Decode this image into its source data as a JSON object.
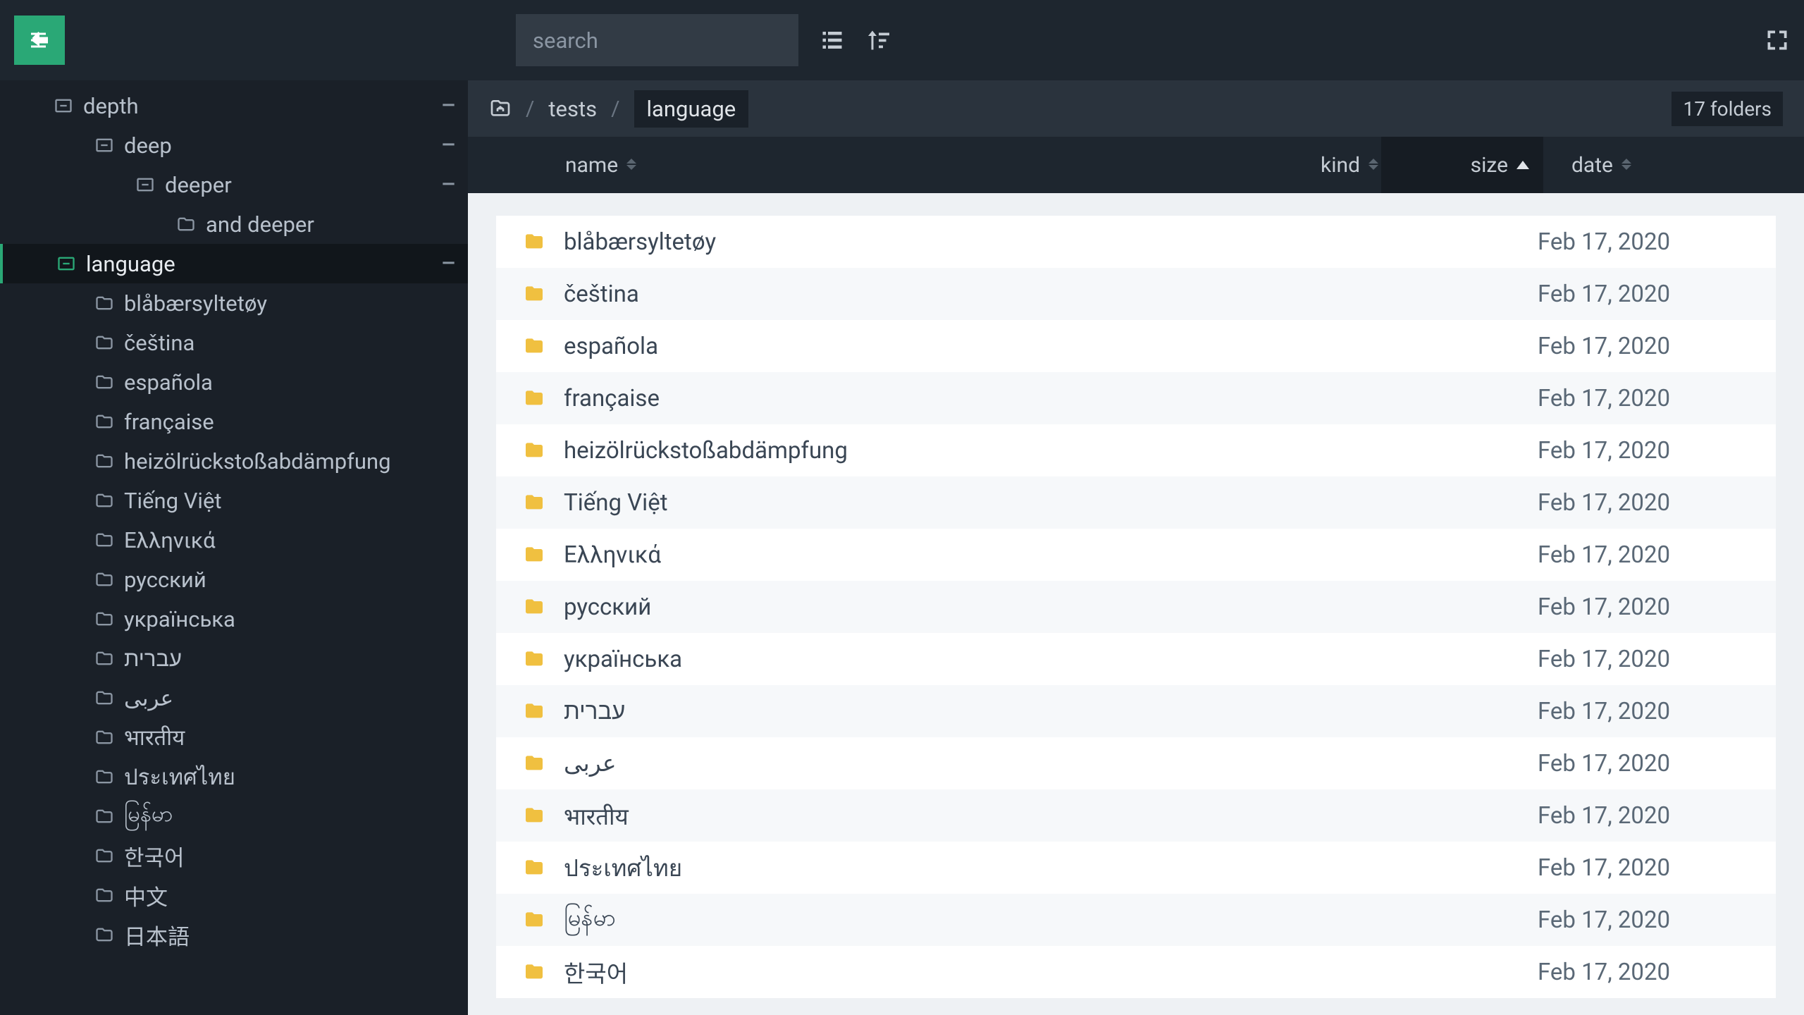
{
  "topbar": {
    "search_placeholder": "search"
  },
  "sidebar": {
    "tree": [
      {
        "label": "depth",
        "depth": 0,
        "icon": "folder-minus",
        "collapse": true,
        "selected": false
      },
      {
        "label": "deep",
        "depth": 1,
        "icon": "folder-minus",
        "collapse": true,
        "selected": false
      },
      {
        "label": "deeper",
        "depth": 2,
        "icon": "folder-minus",
        "collapse": true,
        "selected": false
      },
      {
        "label": "and deeper",
        "depth": 3,
        "icon": "folder",
        "collapse": false,
        "selected": false
      },
      {
        "label": "language",
        "depth": 0,
        "icon": "folder-minus-green",
        "collapse": true,
        "selected": true
      },
      {
        "label": "blåbærsyltetøy",
        "depth": 1,
        "icon": "folder",
        "collapse": false,
        "selected": false
      },
      {
        "label": "čeština",
        "depth": 1,
        "icon": "folder",
        "collapse": false,
        "selected": false
      },
      {
        "label": "española",
        "depth": 1,
        "icon": "folder",
        "collapse": false,
        "selected": false
      },
      {
        "label": "française",
        "depth": 1,
        "icon": "folder",
        "collapse": false,
        "selected": false
      },
      {
        "label": "heizölrückstoßabdämpfung",
        "depth": 1,
        "icon": "folder",
        "collapse": false,
        "selected": false
      },
      {
        "label": "Tiếng Việt",
        "depth": 1,
        "icon": "folder",
        "collapse": false,
        "selected": false
      },
      {
        "label": "Ελληνικά",
        "depth": 1,
        "icon": "folder",
        "collapse": false,
        "selected": false
      },
      {
        "label": "русский",
        "depth": 1,
        "icon": "folder",
        "collapse": false,
        "selected": false
      },
      {
        "label": "українська",
        "depth": 1,
        "icon": "folder",
        "collapse": false,
        "selected": false
      },
      {
        "label": "עברית",
        "depth": 1,
        "icon": "folder",
        "collapse": false,
        "selected": false
      },
      {
        "label": "عربى",
        "depth": 1,
        "icon": "folder",
        "collapse": false,
        "selected": false
      },
      {
        "label": "भारतीय",
        "depth": 1,
        "icon": "folder",
        "collapse": false,
        "selected": false
      },
      {
        "label": "ประเทศไทย",
        "depth": 1,
        "icon": "folder",
        "collapse": false,
        "selected": false
      },
      {
        "label": "မြန်မာ",
        "depth": 1,
        "icon": "folder",
        "collapse": false,
        "selected": false
      },
      {
        "label": "한국어",
        "depth": 1,
        "icon": "folder",
        "collapse": false,
        "selected": false
      },
      {
        "label": "中文",
        "depth": 1,
        "icon": "folder",
        "collapse": false,
        "selected": false
      },
      {
        "label": "日本語",
        "depth": 1,
        "icon": "folder",
        "collapse": false,
        "selected": false
      }
    ]
  },
  "breadcrumb": {
    "segments": [
      "tests",
      "language"
    ],
    "count_label": "17 folders"
  },
  "columns": {
    "name": "name",
    "kind": "kind",
    "size": "size",
    "date": "date",
    "sort_active": "size",
    "sort_dir": "asc"
  },
  "files": [
    {
      "name": "blåbærsyltetøy",
      "date": "Feb 17, 2020"
    },
    {
      "name": "čeština",
      "date": "Feb 17, 2020"
    },
    {
      "name": "española",
      "date": "Feb 17, 2020"
    },
    {
      "name": "française",
      "date": "Feb 17, 2020"
    },
    {
      "name": "heizölrückstoßabdämpfung",
      "date": "Feb 17, 2020"
    },
    {
      "name": "Tiếng Việt",
      "date": "Feb 17, 2020"
    },
    {
      "name": "Ελληνικά",
      "date": "Feb 17, 2020"
    },
    {
      "name": "русский",
      "date": "Feb 17, 2020"
    },
    {
      "name": "українська",
      "date": "Feb 17, 2020"
    },
    {
      "name": "עברית",
      "date": "Feb 17, 2020"
    },
    {
      "name": "عربى",
      "date": "Feb 17, 2020"
    },
    {
      "name": "भारतीय",
      "date": "Feb 17, 2020"
    },
    {
      "name": "ประเทศไทย",
      "date": "Feb 17, 2020"
    },
    {
      "name": "မြန်မာ",
      "date": "Feb 17, 2020"
    },
    {
      "name": "한국어",
      "date": "Feb 17, 2020"
    }
  ]
}
